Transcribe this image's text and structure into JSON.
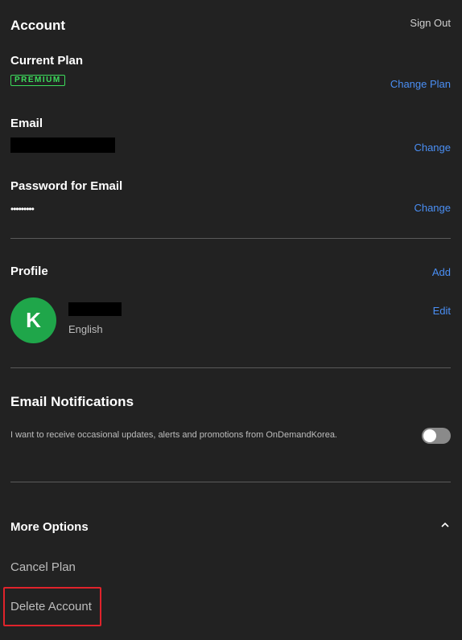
{
  "header": {
    "title": "Account",
    "sign_out": "Sign Out"
  },
  "plan": {
    "label": "Current Plan",
    "badge": "PREMIUM",
    "change_label": "Change Plan"
  },
  "email": {
    "label": "Email",
    "change_label": "Change"
  },
  "password": {
    "label": "Password for Email",
    "value": "•••••••••",
    "change_label": "Change"
  },
  "profile": {
    "label": "Profile",
    "add_label": "Add",
    "edit_label": "Edit",
    "avatar_initial": "K",
    "language": "English"
  },
  "notifications": {
    "title": "Email Notifications",
    "description": "I want to receive occasional updates, alerts and promotions from OnDemandKorea.",
    "enabled": false
  },
  "more_options": {
    "title": "More Options",
    "cancel_plan": "Cancel Plan",
    "delete_account": "Delete Account"
  },
  "colors": {
    "background": "#222222",
    "link": "#4a8ff5",
    "badge": "#3ddc5c",
    "avatar": "#1fa64a",
    "highlight": "#e0232b"
  }
}
